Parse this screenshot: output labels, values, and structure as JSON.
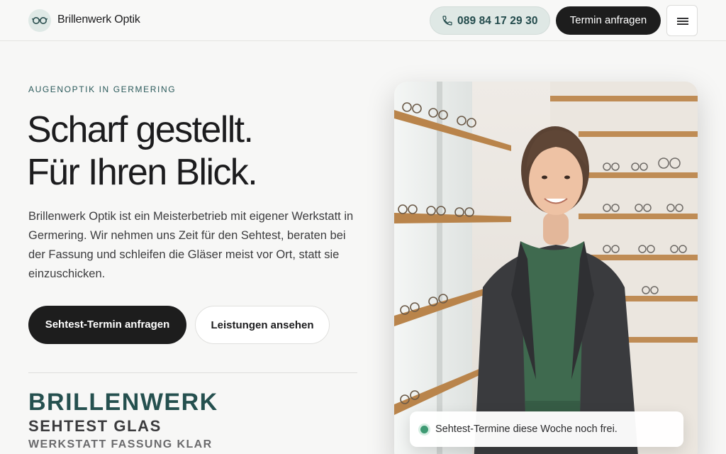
{
  "header": {
    "brand": "Brillenwerk Optik",
    "logo_icon": "glasses-icon",
    "phone_icon": "phone-icon",
    "phone": "089 84 17 29 30",
    "cta": "Termin anfragen",
    "menu_icon": "hamburger-menu-icon"
  },
  "hero": {
    "eyebrow": "AUGENOPTIK IN GERMERING",
    "headline_line1": "Scharf gestellt.",
    "headline_line2": "Für Ihren Blick.",
    "lead": "Brillenwerk Optik ist ein Meisterbetrieb mit eigener Werkstatt in Germering. Wir nehmen uns Zeit für den Sehtest, beraten bei der Fassung und schleifen die Gläser meist vor Ort, statt sie einzuschicken.",
    "primary_cta": "Sehtest-Termin anfragen",
    "secondary_cta": "Leistungen ansehen"
  },
  "ticker": {
    "line1": "BRILLENWERK",
    "line2": "SEHTEST GLAS",
    "line3": "WERKSTATT FASSUNG KLAR"
  },
  "status": {
    "text": "Sehtest-Termine diese Woche noch frei.",
    "dot_color": "#3e9a73"
  },
  "colors": {
    "accent": "#25504f",
    "dark": "#1d1d1d",
    "phone_bg": "#dfe8e5",
    "background": "#f7f7f6"
  }
}
